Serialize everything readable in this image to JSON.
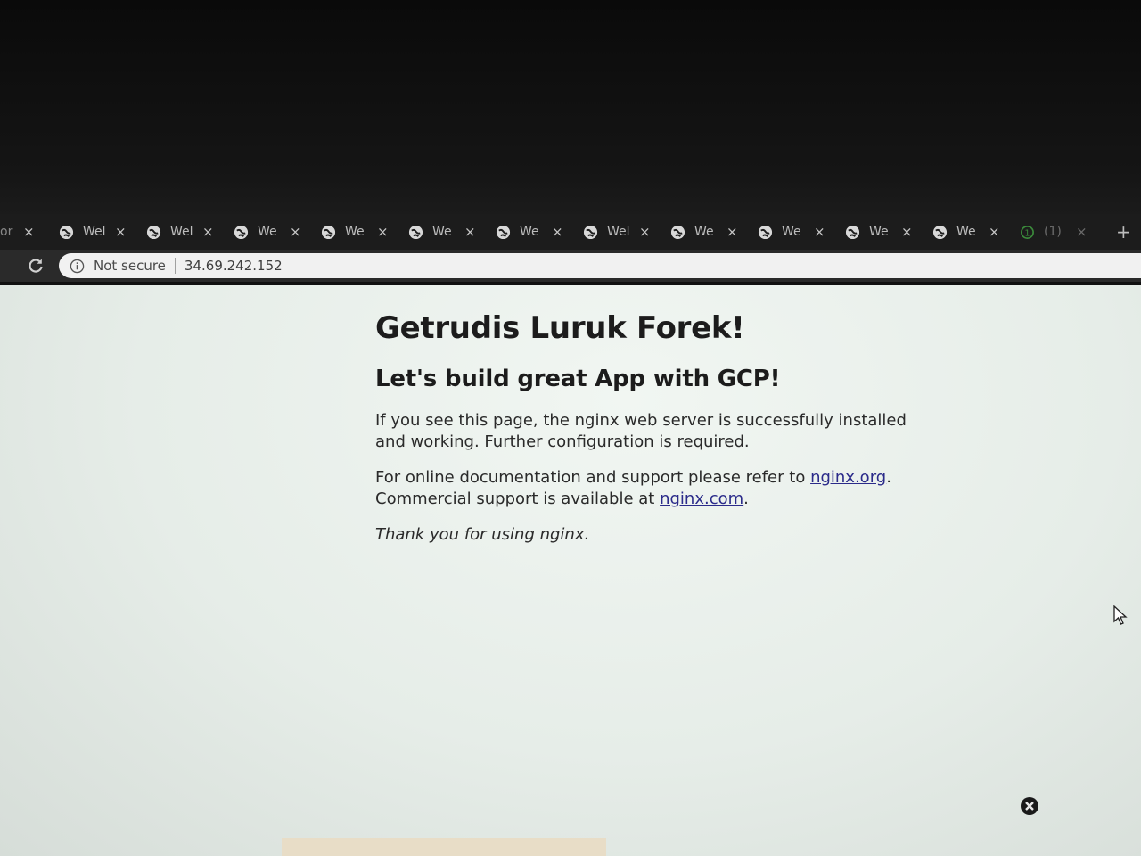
{
  "browser": {
    "tabs": [
      {
        "title": "or",
        "close": "×"
      },
      {
        "title": "Wel",
        "close": "×"
      },
      {
        "title": "Wel",
        "close": "×"
      },
      {
        "title": "We",
        "close": "×"
      },
      {
        "title": "We",
        "close": "×"
      },
      {
        "title": "We",
        "close": "×"
      },
      {
        "title": "We",
        "close": "×"
      },
      {
        "title": "Wel",
        "close": "×"
      },
      {
        "title": "We",
        "close": "×"
      },
      {
        "title": "We",
        "close": "×"
      },
      {
        "title": "We",
        "close": "×"
      },
      {
        "title": "We",
        "close": "×"
      },
      {
        "title": "(1)",
        "close": "×"
      }
    ],
    "new_tab": "+",
    "omnibox": {
      "security": "Not secure",
      "url": "34.69.242.152"
    }
  },
  "page": {
    "heading": "Getrudis Luruk Forek!",
    "subheading": "Let's build great App with GCP!",
    "para1": "If you see this page, the nginx web server is successfully installed and working. Further configuration is required.",
    "para2_prefix": "For online documentation and support please refer to ",
    "link1": "nginx.org",
    "para2_mid": ".",
    "para2_line2": "Commercial support is available at ",
    "link2": "nginx.com",
    "para2_end": ".",
    "thanks": "Thank you for using nginx."
  },
  "colors": {
    "link": "#2b2b8a",
    "page_bg": "#eaf0ec",
    "tabstrip_bg": "#1c1c1c"
  }
}
